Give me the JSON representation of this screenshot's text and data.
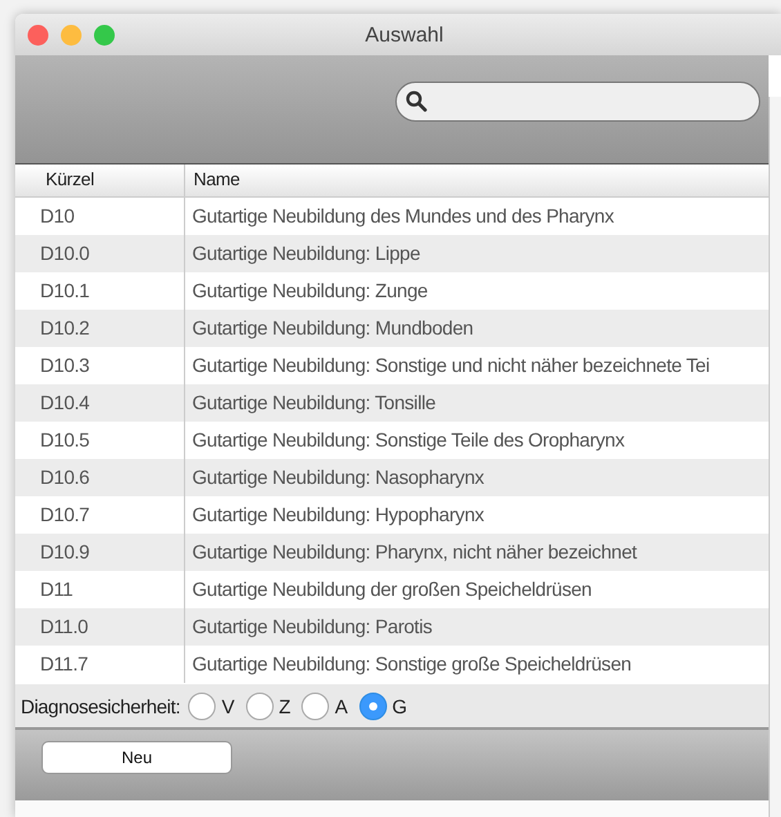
{
  "window": {
    "title": "Auswahl"
  },
  "table": {
    "columns": [
      "Kürzel",
      "Name"
    ],
    "rows": [
      {
        "code": "D10",
        "name": "Gutartige Neubildung des Mundes und des Pharynx"
      },
      {
        "code": "D10.0",
        "name": "Gutartige Neubildung: Lippe"
      },
      {
        "code": "D10.1",
        "name": "Gutartige Neubildung: Zunge"
      },
      {
        "code": "D10.2",
        "name": "Gutartige Neubildung: Mundboden"
      },
      {
        "code": "D10.3",
        "name": "Gutartige Neubildung: Sonstige und nicht näher bezeichnete Tei"
      },
      {
        "code": "D10.4",
        "name": "Gutartige Neubildung: Tonsille"
      },
      {
        "code": "D10.5",
        "name": "Gutartige Neubildung: Sonstige Teile des Oropharynx"
      },
      {
        "code": "D10.6",
        "name": "Gutartige Neubildung: Nasopharynx"
      },
      {
        "code": "D10.7",
        "name": "Gutartige Neubildung: Hypopharynx"
      },
      {
        "code": "D10.9",
        "name": "Gutartige Neubildung: Pharynx, nicht näher bezeichnet"
      },
      {
        "code": "D11",
        "name": "Gutartige Neubildung der großen Speicheldrüsen"
      },
      {
        "code": "D11.0",
        "name": "Gutartige Neubildung: Parotis"
      },
      {
        "code": "D11.7",
        "name": "Gutartige Neubildung: Sonstige große Speicheldrüsen"
      }
    ]
  },
  "certainty": {
    "label": "Diagnosesicherheit:",
    "options": [
      {
        "label": "V",
        "selected": false
      },
      {
        "label": "Z",
        "selected": false
      },
      {
        "label": "A",
        "selected": false
      },
      {
        "label": "G",
        "selected": true
      }
    ]
  },
  "buttons": [
    "Neu"
  ]
}
